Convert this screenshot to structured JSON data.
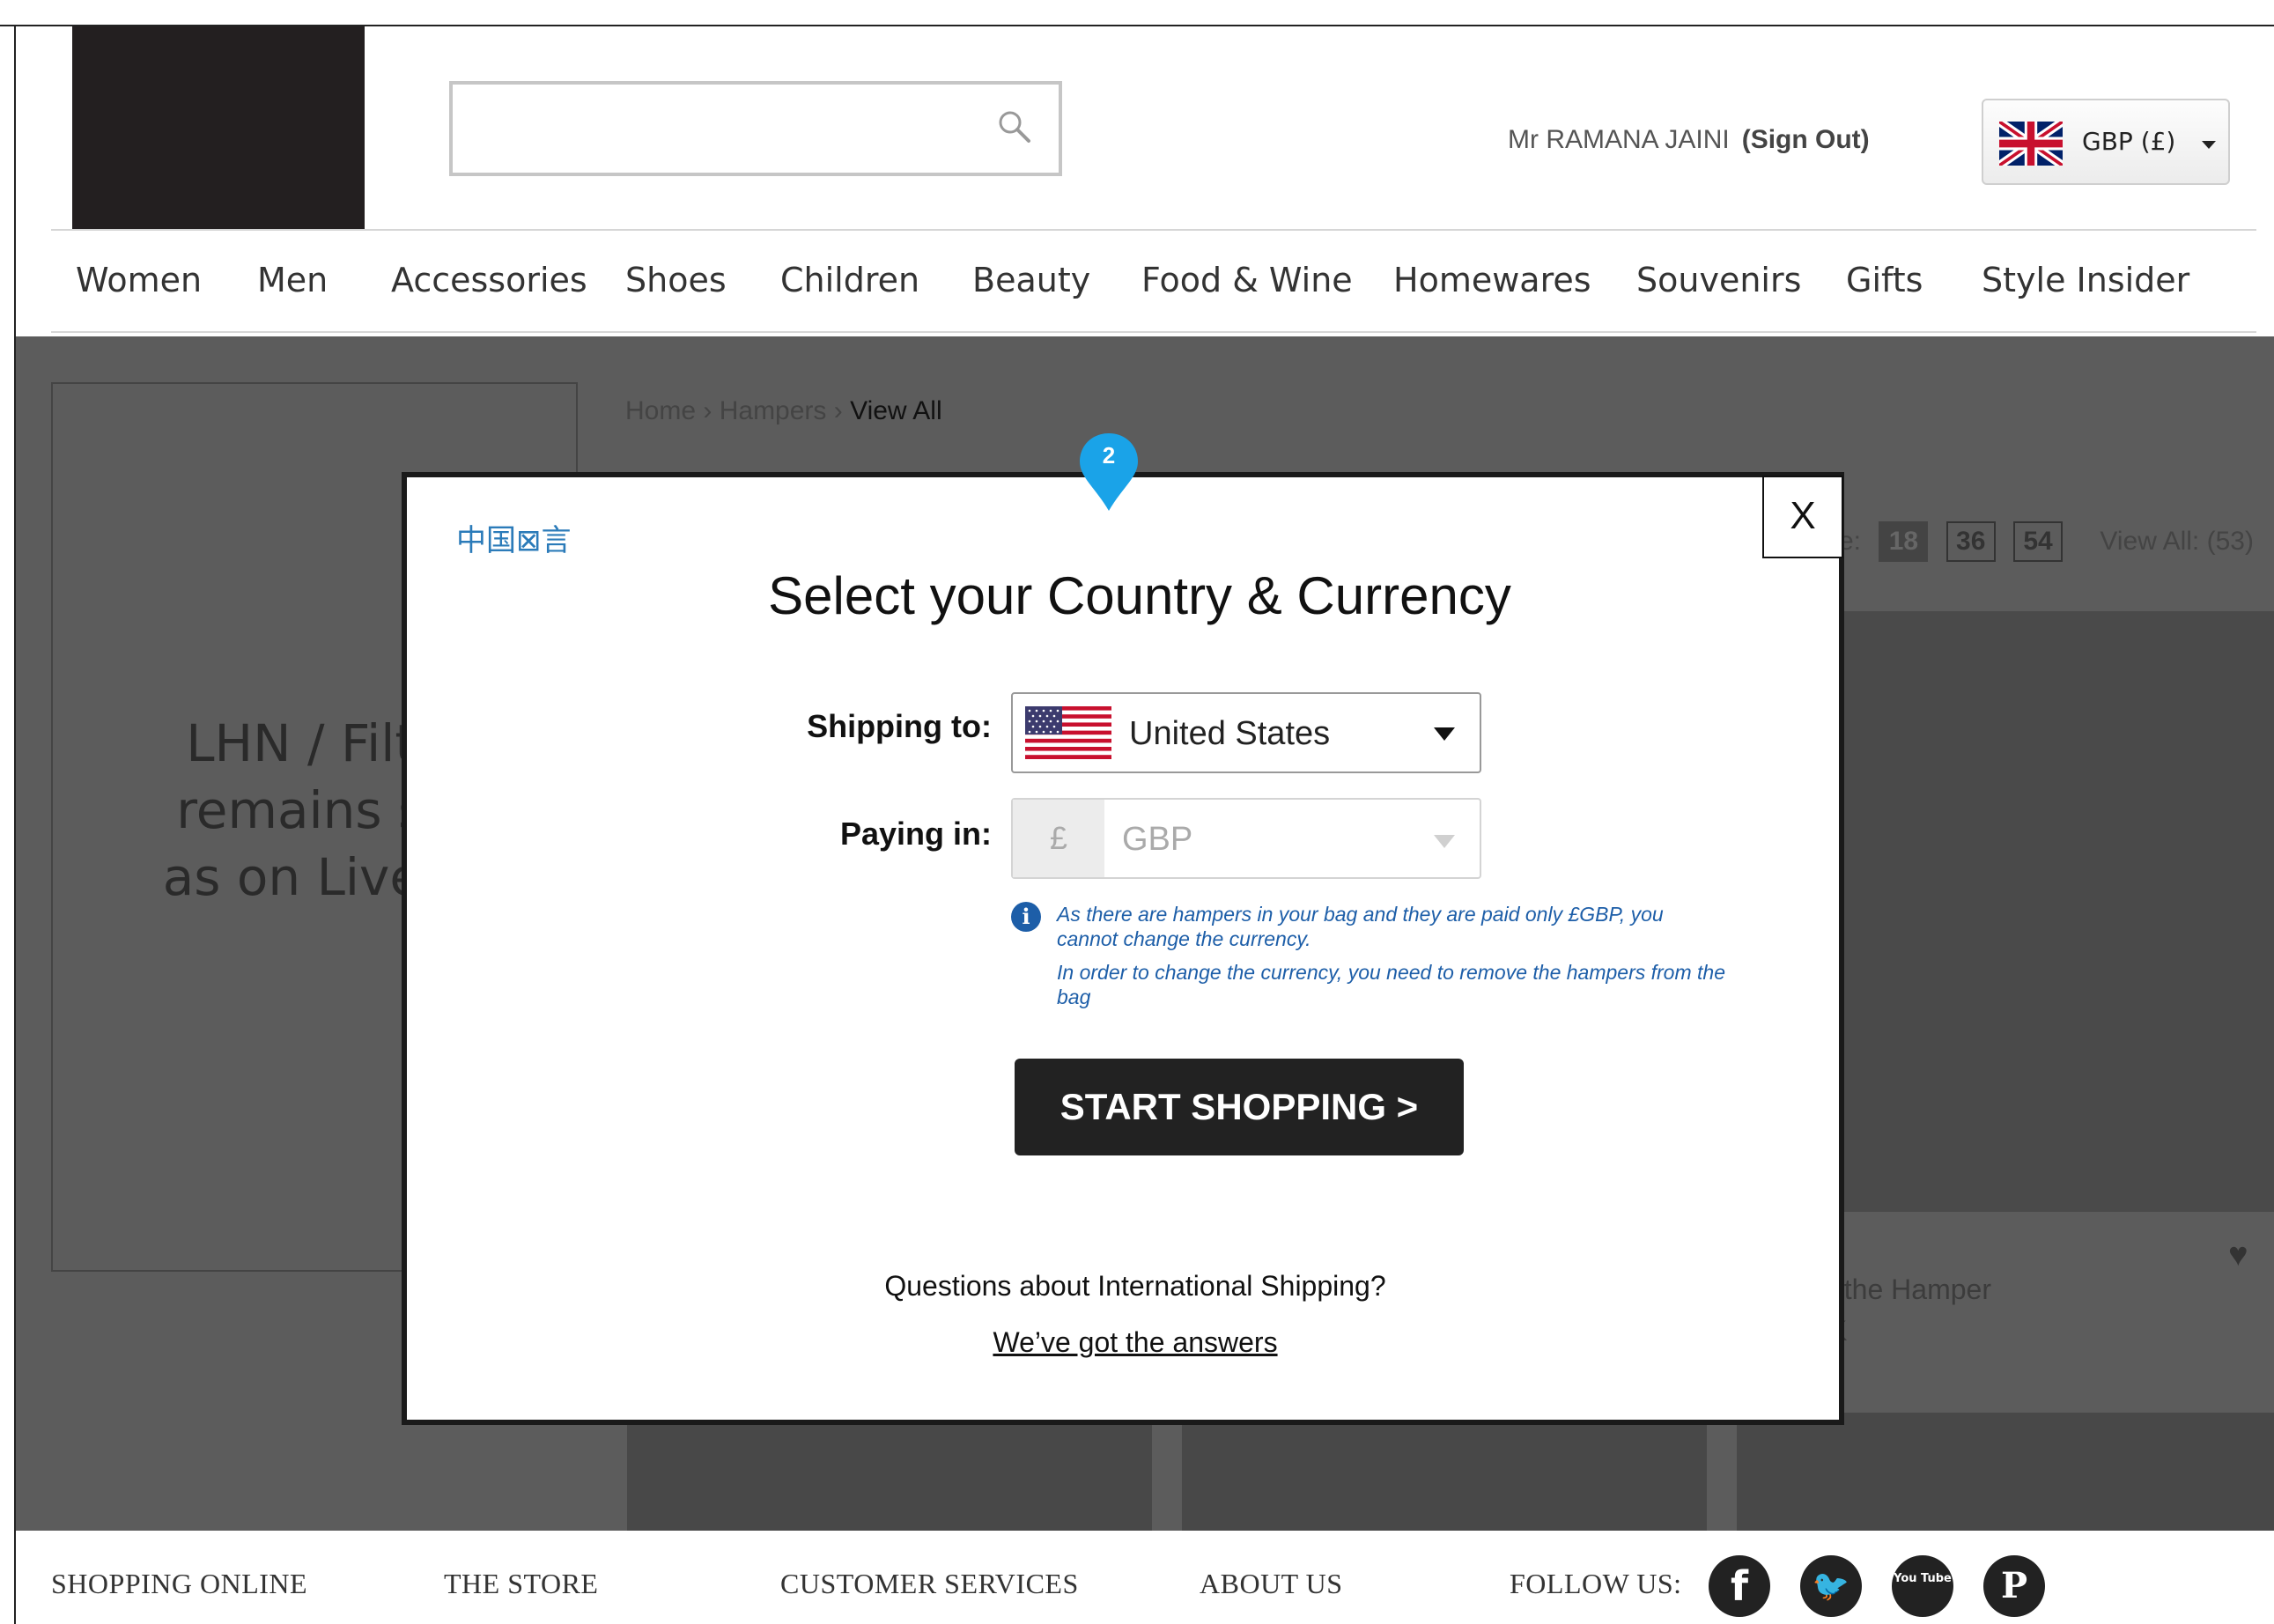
{
  "header": {
    "search": {
      "value": "",
      "placeholder": "",
      "icon": "search-icon"
    },
    "user": {
      "name": "Mr RAMANA JAINI",
      "sign_out": "(Sign Out)"
    },
    "currency": {
      "label": "GBP (£)",
      "flag_icon": "uk-flag-icon"
    }
  },
  "nav": {
    "items": [
      "Women",
      "Men",
      "Accessories",
      "Shoes",
      "Children",
      "Beauty",
      "Food & Wine",
      "Homewares",
      "Souvenirs",
      "Gifts",
      "Style Insider"
    ]
  },
  "page": {
    "lhn_note": "LHN / Filte\nremains  sa\nas on Live S",
    "breadcrumb": {
      "home": "Home",
      "sep": "›",
      "category": "Hampers",
      "current": "View All"
    },
    "pager": {
      "label": "e:",
      "sizes": [
        "18",
        "36",
        "54"
      ],
      "selected": "18",
      "view_all": "View All: (53)"
    },
    "product_text": {
      "line1": "f the Hamper",
      "line2": "K"
    }
  },
  "modal": {
    "language_link": "中国⊠言",
    "title": "Select your Country & Currency",
    "close_label": "X",
    "shipping_label": "Shipping to:",
    "shipping_value": "United States",
    "shipping_flag_icon": "us-flag-icon",
    "paying_label": "Paying in:",
    "paying_symbol": "£",
    "paying_value": "GBP",
    "info_line1": "As there are hampers in your bag and they are paid only £GBP, you cannot change the currency.",
    "info_line2": "In order to change the currency, you need to remove the hampers from the bag",
    "start_button": "START SHOPPING >",
    "question": "Questions about International Shipping?",
    "answers_link": "We’ve got the answers"
  },
  "annotation": {
    "number": "2",
    "color": "#1aa3e8"
  },
  "footer": {
    "links": [
      "SHOPPING ONLINE",
      "THE STORE",
      "CUSTOMER SERVICES",
      "ABOUT US",
      "FOLLOW US:"
    ],
    "social": [
      {
        "icon": "facebook-icon",
        "glyph": "f"
      },
      {
        "icon": "twitter-icon",
        "glyph": "🐦"
      },
      {
        "icon": "youtube-icon",
        "glyph": "You Tube"
      },
      {
        "icon": "pinterest-icon",
        "glyph": "P"
      }
    ]
  },
  "colors": {
    "accent_blue": "#1d5ea8",
    "link_blue": "#2b7bb9",
    "pin_blue": "#1aa3e8",
    "overlay_grey": "#5c5c5c",
    "button_dark": "#222222"
  }
}
